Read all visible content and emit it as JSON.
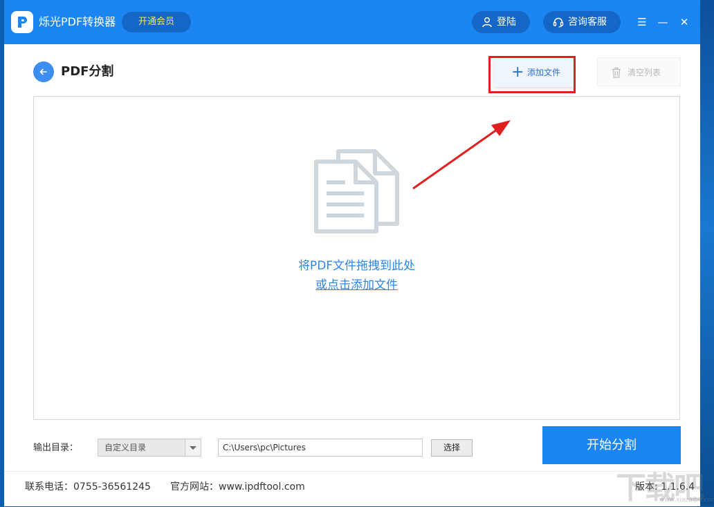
{
  "app": {
    "title": "烁光PDF转换器",
    "vip_label": "开通会员",
    "login_label": "登陆",
    "service_label": "咨询客服"
  },
  "icons": {
    "logo": "pdf-logo-icon",
    "user": "user-icon",
    "headset": "headset-icon",
    "menu": "menu-icon",
    "minimize": "minimize-icon",
    "close": "close-icon",
    "back": "arrow-left-icon",
    "plus": "plus-icon",
    "trash": "trash-icon",
    "docs": "documents-icon",
    "dropdown": "chevron-down-icon"
  },
  "glyphs": {
    "menu": "☰",
    "minimize": "—",
    "close": "✕",
    "plus": "+"
  },
  "page": {
    "title": "PDF分割",
    "add_file_label": "添加文件",
    "clear_list_label": "清空列表"
  },
  "dropzone": {
    "line1": "将PDF文件拖拽到此处",
    "line2": "或点击添加文件"
  },
  "output": {
    "label": "输出目录：",
    "mode_selected": "自定义目录",
    "path_value": "C:\\Users\\pc\\Pictures",
    "choose_label": "选择",
    "start_label": "开始分割"
  },
  "footer": {
    "phone": "联系电话：0755-36561245",
    "website": "官方网站：www.ipdftool.com",
    "version": "版本: 1.1.6.4"
  },
  "watermark": {
    "text": "下载吧",
    "sub": "www.xiazaiba.com"
  },
  "colors": {
    "primary": "#1b86f2",
    "primary_dark": "#1466c7",
    "vip_text": "#f5e45c",
    "link": "#2b86e6",
    "highlight_red": "#e02020"
  }
}
